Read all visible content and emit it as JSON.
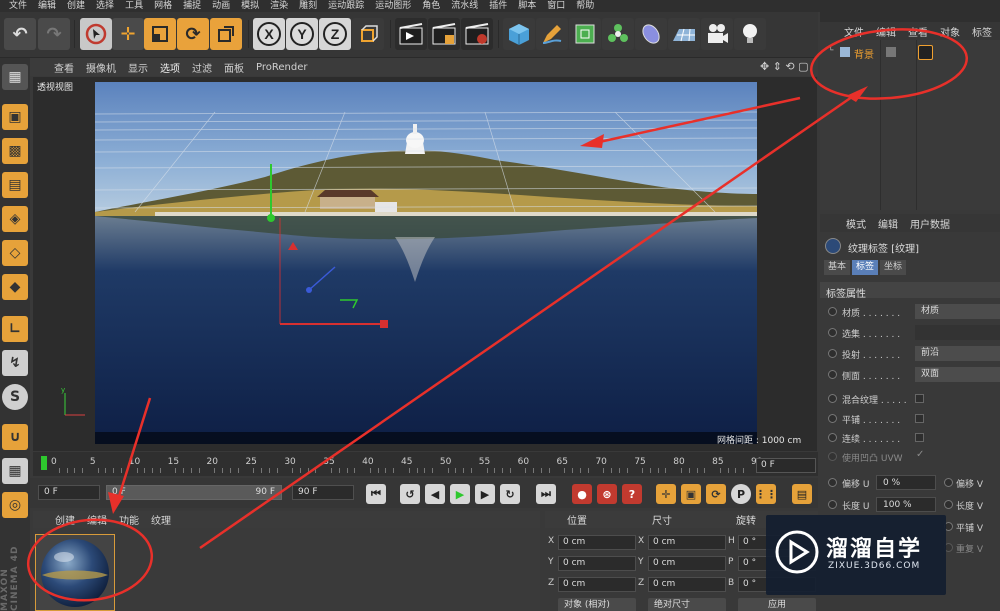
{
  "menu": [
    "文件",
    "编辑",
    "创建",
    "选择",
    "工具",
    "网格",
    "捕捉",
    "动画",
    "模拟",
    "渲染",
    "雕刻",
    "运动跟踪",
    "运动图形",
    "角色",
    "流水线",
    "插件",
    "脚本",
    "窗口",
    "帮助"
  ],
  "toolbar": {
    "axis_x": "X",
    "axis_y": "Y",
    "axis_z": "Z",
    "icons": [
      "undo-icon",
      "redo-icon",
      "live-select-icon",
      "move-icon",
      "scale-icon",
      "rotate-icon",
      "recent-tool-icon",
      "axis-x-icon",
      "axis-y-icon",
      "axis-z-icon",
      "coordinate-system-icon",
      "render-view-icon",
      "render-picture-viewer-icon",
      "render-settings-icon",
      "cube-icon",
      "pen-icon",
      "subdivision-icon",
      "cloner-icon",
      "deformer-icon",
      "floor-icon",
      "camera-icon",
      "light-icon"
    ]
  },
  "viewport": {
    "menu": [
      "查看",
      "摄像机",
      "显示",
      "选项",
      "过滤",
      "面板",
      "ProRender"
    ],
    "label": "透视视图",
    "grid_spacing": "网格间距 : 1000 cm"
  },
  "timeline": {
    "ticks": [
      "0",
      "5",
      "10",
      "15",
      "20",
      "25",
      "30",
      "35",
      "40",
      "45",
      "50",
      "55",
      "60",
      "65",
      "70",
      "75",
      "80",
      "85",
      "90"
    ],
    "current_frame": "0 F"
  },
  "transport": {
    "start_frame": "0 F",
    "min_frame": "0 F",
    "slider_end": "90 F",
    "end_frame": "90 F"
  },
  "material_manager": {
    "menu": [
      "创建",
      "编辑",
      "功能",
      "纹理"
    ]
  },
  "brand_vertical": "MAXON CINEMA 4D",
  "coordinates": {
    "headers": [
      "位置",
      "尺寸",
      "旋转"
    ],
    "rows": [
      {
        "axis": "X",
        "pos": "0 cm",
        "size_axis": "X",
        "size": "0 cm",
        "rot_axis": "H",
        "rot": "0 °"
      },
      {
        "axis": "Y",
        "pos": "0 cm",
        "size_axis": "Y",
        "size": "0 cm",
        "rot_axis": "P",
        "rot": "0 °"
      },
      {
        "axis": "Z",
        "pos": "0 cm",
        "size_axis": "Z",
        "size": "0 cm",
        "rot_axis": "B",
        "rot": "0 °"
      }
    ],
    "mode_object": "对象 (相对)",
    "mode_size": "绝对尺寸",
    "apply_button": "应用"
  },
  "object_manager": {
    "menu": [
      "文件",
      "编辑",
      "查看",
      "对象",
      "标签"
    ],
    "object_name": "背景"
  },
  "attribute_manager": {
    "menu": [
      "模式",
      "编辑",
      "用户数据"
    ],
    "title": "纹理标签 [纹理]",
    "tabs": [
      "基本",
      "标签",
      "坐标"
    ],
    "section": "标签属性",
    "rows": [
      {
        "label": "材质 . . . . . . .",
        "value": "材质"
      },
      {
        "label": "选集 . . . . . . .",
        "value": ""
      },
      {
        "label": "投射 . . . . . . .",
        "value": "前沿"
      },
      {
        "label": "侧面 . . . . . . .",
        "value": "双面"
      }
    ],
    "checks": [
      "混合纹理 . . . . .",
      "平铺 . . . . . . .",
      "连续 . . . . . . .",
      "使用凹凸 UVW"
    ],
    "offset_u_label": "偏移 U",
    "offset_u": "0 %",
    "offset_v_label": "偏移 V",
    "length_u_label": "长度 U",
    "length_u": "100 %",
    "length_v_label": "长度 V",
    "tile_label": "平铺 V",
    "repeat_label": "重复 V"
  },
  "watermark": {
    "brand_cn": "溜溜自学",
    "brand_url": "ZIXUE.3D66.COM"
  },
  "colors": {
    "accent_orange": "#e6a23a",
    "annotation_red": "#e8302a",
    "active_menu_blue": "#5a7fb8"
  }
}
